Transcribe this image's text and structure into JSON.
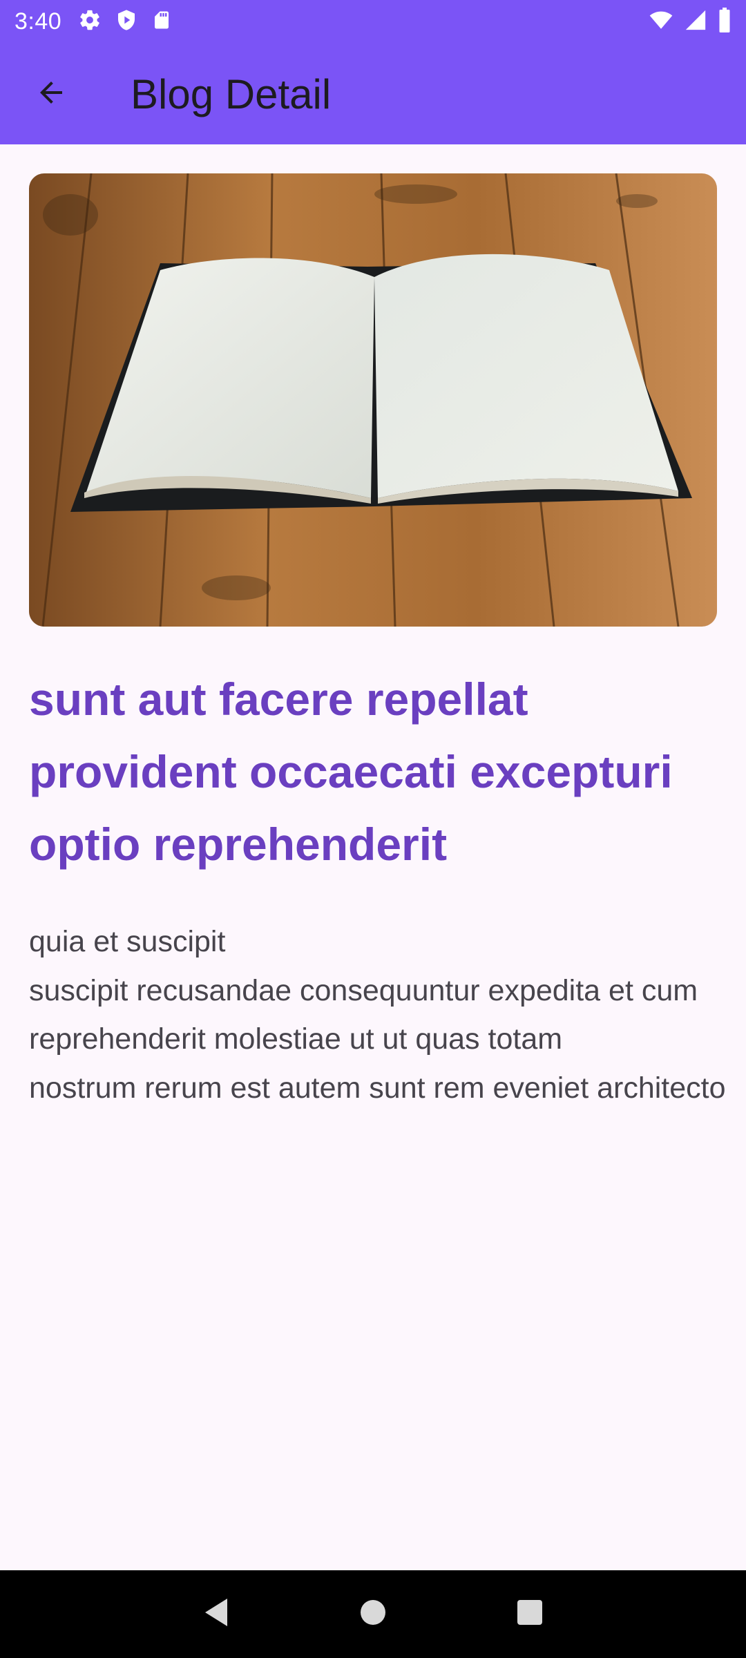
{
  "status_bar": {
    "time": "3:40",
    "icons_left": [
      "gear-icon",
      "shield-icon",
      "sd-card-icon"
    ],
    "icons_right": [
      "wifi-icon",
      "signal-icon",
      "battery-icon"
    ]
  },
  "app_bar": {
    "back_icon": "arrow-back-icon",
    "title": "Blog Detail",
    "background": "#7b54f6"
  },
  "post": {
    "image": "open-book-on-wooden-table",
    "title": "sunt aut facere repellat provident occaecati excepturi optio reprehenderit",
    "body": "quia et suscipit\nsuscipit recusandae consequuntur expedita et cum\nreprehenderit molestiae ut ut quas totam\nnostrum rerum est autem sunt rem eveniet architecto",
    "title_color": "#6a3fc0",
    "body_color": "#47444c"
  },
  "nav_bar": {
    "buttons": [
      "back-triangle-icon",
      "home-circle-icon",
      "recents-square-icon"
    ]
  }
}
